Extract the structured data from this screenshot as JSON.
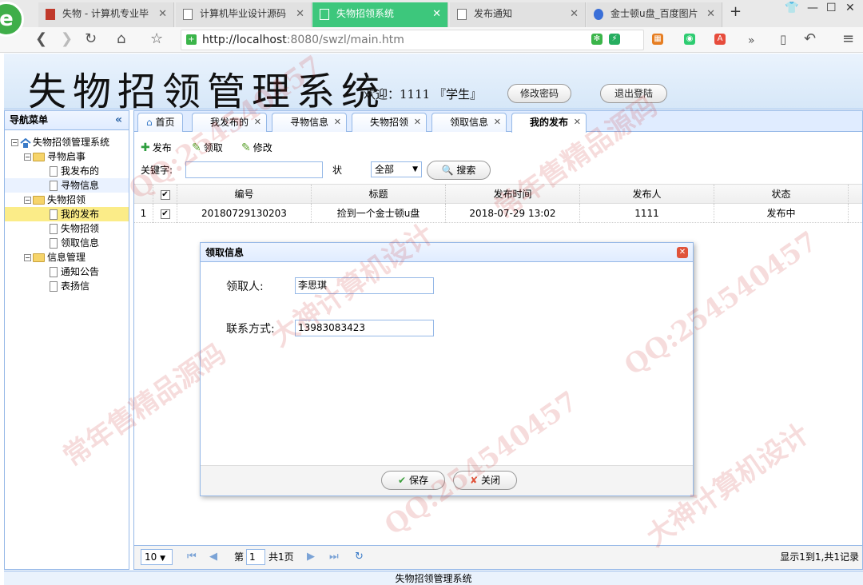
{
  "browser": {
    "tabs": [
      {
        "label": "失物 - 计算机专业毕"
      },
      {
        "label": "计算机毕业设计源码"
      },
      {
        "label": "失物招领系统"
      },
      {
        "label": "发布通知"
      },
      {
        "label": "金士顿u盘_百度图片"
      }
    ],
    "url_host": "http://localhost",
    "url_path": ":8080/swzl/main.htm",
    "logo": "e"
  },
  "header": {
    "title": "失物招领管理系统",
    "welcome": "欢迎：1111 『学生』",
    "change_password": "修改密码",
    "logout": "退出登陆"
  },
  "sidebar": {
    "title": "导航菜单",
    "root": "失物招领管理系统",
    "groups": [
      {
        "label": "寻物启事",
        "items": [
          {
            "label": "我发布的"
          },
          {
            "label": "寻物信息"
          }
        ]
      },
      {
        "label": "失物招领",
        "items": [
          {
            "label": "我的发布"
          },
          {
            "label": "失物招领"
          },
          {
            "label": "领取信息"
          }
        ]
      },
      {
        "label": "信息管理",
        "items": [
          {
            "label": "通知公告"
          },
          {
            "label": "表扬信"
          }
        ]
      }
    ]
  },
  "content_tabs": [
    {
      "label": "首页"
    },
    {
      "label": "我发布的"
    },
    {
      "label": "寻物信息"
    },
    {
      "label": "失物招领"
    },
    {
      "label": "领取信息"
    },
    {
      "label": "我的发布"
    }
  ],
  "toolbar": {
    "publish": "发布",
    "claim": "领取",
    "edit": "修改"
  },
  "search": {
    "keyword_label": "关键字:",
    "status_label": "状态:",
    "status_value": "全部",
    "search_button": "搜索"
  },
  "table": {
    "columns": [
      "编号",
      "标题",
      "发布时间",
      "发布人",
      "状态"
    ],
    "rows": [
      {
        "index": "1",
        "id": "20180729130203",
        "title": "捡到一个金士顿u盘",
        "time": "2018-07-29 13:02",
        "publisher": "1111",
        "status": "发布中"
      }
    ]
  },
  "pager": {
    "page_size": "10",
    "page_prefix": "第",
    "page": "1",
    "total_pages": "共1页",
    "summary": "显示1到1,共1记录"
  },
  "dialog": {
    "title": "领取信息",
    "claimant_label": "领取人:",
    "claimant_value": "李思琪",
    "contact_label": "联系方式:",
    "contact_value": "13983083423",
    "save": "保存",
    "close": "关闭"
  },
  "footer": "失物招领管理系统",
  "watermarks": [
    "QQ:254540457",
    "常年售精品源码",
    "大神计算机设计"
  ],
  "colors": {
    "accent": "#95b8e7",
    "active_tab": "#3dc77c",
    "selected_node": "#fbec88"
  }
}
